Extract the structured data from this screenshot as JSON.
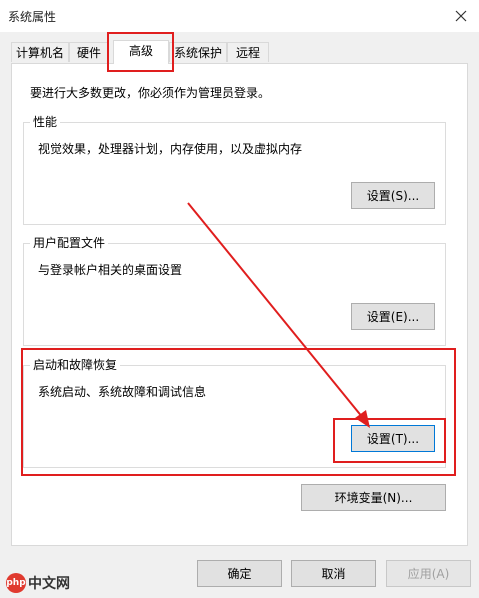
{
  "window": {
    "title": "系统属性"
  },
  "tabs": [
    {
      "label": "计算机名"
    },
    {
      "label": "硬件"
    },
    {
      "label": "高级"
    },
    {
      "label": "系统保护"
    },
    {
      "label": "远程"
    }
  ],
  "hint": "要进行大多数更改，你必须作为管理员登录。",
  "groups": {
    "performance": {
      "title": "性能",
      "desc": "视觉效果，处理器计划，内存使用，以及虚拟内存",
      "button": "设置(S)..."
    },
    "profile": {
      "title": "用户配置文件",
      "desc": "与登录帐户相关的桌面设置",
      "button": "设置(E)..."
    },
    "startup": {
      "title": "启动和故障恢复",
      "desc": "系统启动、系统故障和调试信息",
      "button": "设置(T)..."
    }
  },
  "env_button": "环境变量(N)...",
  "footer": {
    "ok": "确定",
    "cancel": "取消",
    "apply": "应用(A)"
  },
  "watermark": {
    "badge": "php",
    "text": "中文网"
  },
  "colors": {
    "annotation_red": "#e01e1e",
    "accent": "#0078d7"
  }
}
